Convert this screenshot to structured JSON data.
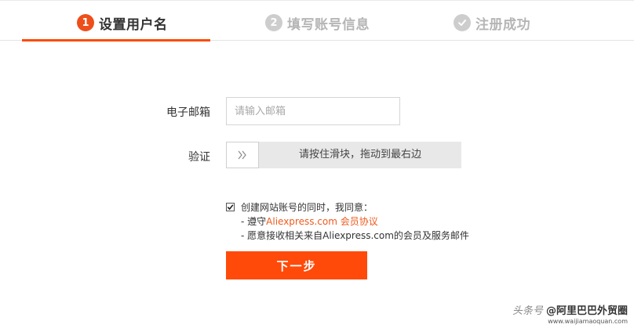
{
  "steps": [
    {
      "num": "1",
      "label": "设置用户名",
      "state": "active"
    },
    {
      "num": "2",
      "label": "填写账号信息",
      "state": "inactive"
    },
    {
      "num": "",
      "label": "注册成功",
      "state": "inactive",
      "icon": "check-circle-icon"
    }
  ],
  "form": {
    "email_label": "电子邮箱",
    "email_placeholder": "请输入邮箱",
    "email_value": "",
    "verify_label": "验证",
    "slider_text": "请按住滑块，拖动到最右边",
    "slider_icon": "double-chevron-right-icon"
  },
  "agreement": {
    "checked": true,
    "lead": "创建网站账号的同时，我同意：",
    "line1_prefix": "- 遵守",
    "line1_link": "Aliexpress.com 会员协议",
    "line2": "- 愿意接收相关来自Aliexpress.com的会员及服务邮件"
  },
  "next_button_label": "下一步",
  "watermark": {
    "prefix": "头条号",
    "title": "@阿里巴巴外贸圈",
    "url": "www.waijiamaoquan.com"
  },
  "colors": {
    "accent": "#ff4a00",
    "step_active": "#ee4f1a",
    "step_inactive": "#cdcdcd",
    "link": "#ee5a1e"
  }
}
